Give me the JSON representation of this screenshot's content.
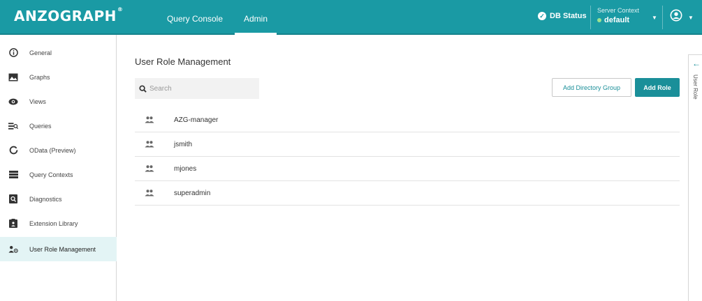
{
  "header": {
    "logo": "ANZOGRAPH",
    "logo_mark": "®",
    "tabs": [
      {
        "label": "Query Console",
        "active": false
      },
      {
        "label": "Admin",
        "active": true
      }
    ],
    "db_status": "DB Status",
    "server_context_label": "Server Context",
    "server_context_value": "default"
  },
  "sidebar": {
    "items": [
      {
        "label": "General",
        "icon": "info-icon"
      },
      {
        "label": "Graphs",
        "icon": "image-icon"
      },
      {
        "label": "Views",
        "icon": "eye-icon"
      },
      {
        "label": "Queries",
        "icon": "query-list-icon"
      },
      {
        "label": "OData (Preview)",
        "icon": "ring-icon"
      },
      {
        "label": "Query Contexts",
        "icon": "list-icon"
      },
      {
        "label": "Diagnostics",
        "icon": "diagnostics-icon"
      },
      {
        "label": "Extension Library",
        "icon": "clipboard-icon"
      },
      {
        "label": "User Role Management",
        "icon": "user-role-icon",
        "active": true
      }
    ]
  },
  "main": {
    "title": "User Role Management",
    "search_placeholder": "Search",
    "add_directory_group": "Add Directory Group",
    "add_role": "Add Role",
    "roles": [
      "AZG-manager",
      "jsmith",
      "mjones",
      "superadmin"
    ]
  },
  "right_panel": {
    "label": "User Role"
  },
  "colors": {
    "accent": "#1a9aa4",
    "button": "#1a8f99",
    "active_bg": "#e3f4f5"
  }
}
